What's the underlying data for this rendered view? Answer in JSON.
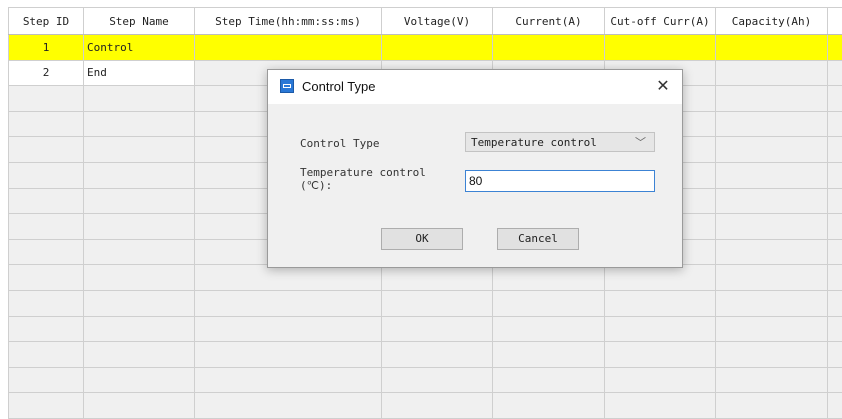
{
  "table": {
    "columns": [
      "Step ID",
      "Step Name",
      "Step Time(hh:mm:ss:ms)",
      "Voltage(V)",
      "Current(A)",
      "Cut-off Curr(A)",
      "Capacity(Ah)",
      ""
    ],
    "rows": [
      {
        "id": "1",
        "name": "Control",
        "selected": true
      },
      {
        "id": "2",
        "name": "End",
        "selected": false
      }
    ],
    "empty_row_count": 13
  },
  "dialog": {
    "title": "Control Type",
    "close_glyph": "✕",
    "control_type_label": "Control Type",
    "control_type_value": "Temperature control",
    "dropdown_arrow": "﹀",
    "temperature_label_line1": "Temperature control",
    "temperature_label_line2": "(℃):",
    "temperature_value": "80",
    "ok_label": "OK",
    "cancel_label": "Cancel"
  },
  "colors": {
    "selected_row": "#ffff00",
    "grid_background": "#f0f0f0",
    "input_focus_border": "#3c83d4",
    "app_icon": "#2a78d6"
  },
  "icons": {
    "app": "app-window-icon",
    "close": "close-icon",
    "dropdown": "chevron-down-icon"
  }
}
